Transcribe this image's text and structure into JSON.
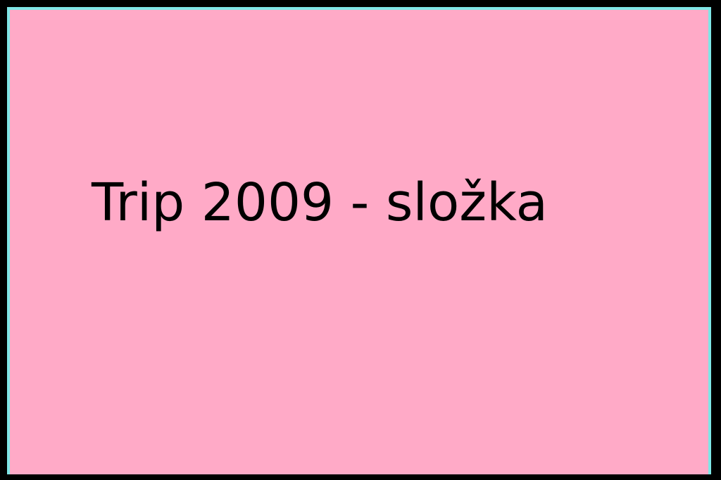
{
  "title": "Trip 2009 - složka",
  "colors": {
    "background": "#ffaac7",
    "border": "#7fe6e6",
    "outer": "#000000",
    "text": "#000000"
  }
}
